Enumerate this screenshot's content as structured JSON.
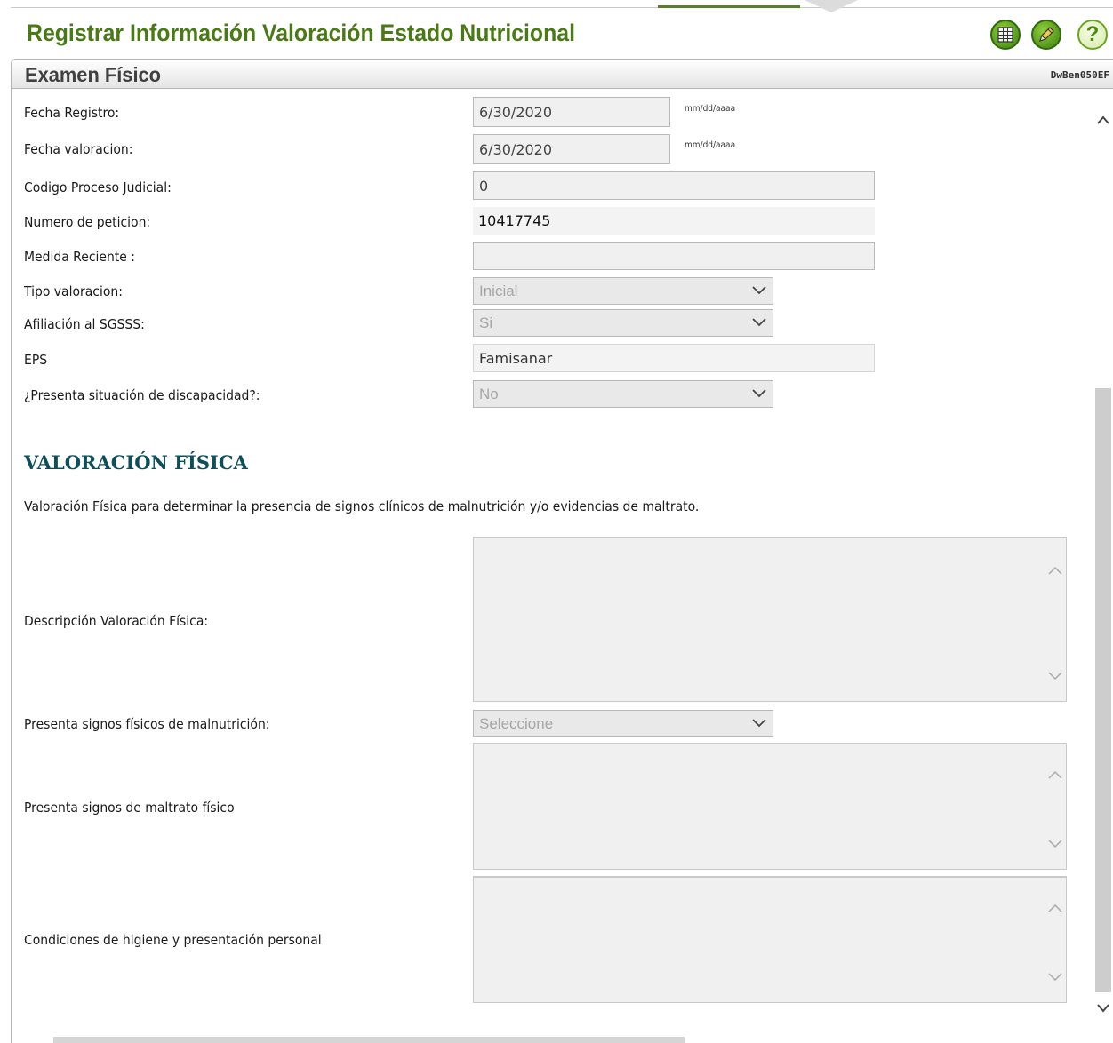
{
  "header": {
    "title": "Registrar Información Valoración Estado Nutricional",
    "icons": [
      "grid-icon",
      "edit-pencil-icon",
      "help-icon"
    ],
    "help_glyph": "?"
  },
  "section": {
    "title": "Examen Físico",
    "form_code": "DwBen050EF"
  },
  "form": {
    "fecha_registro": {
      "label": "Fecha Registro:",
      "value": "6/30/2020",
      "hint": "mm/dd/aaaa"
    },
    "fecha_valoracion": {
      "label": "Fecha valoracion:",
      "value": "6/30/2020",
      "hint": "mm/dd/aaaa"
    },
    "codigo_proceso": {
      "label": "Codigo Proceso Judicial:",
      "value": "0"
    },
    "numero_peticion": {
      "label": "Numero de peticion:",
      "value": "10417745"
    },
    "medida_reciente": {
      "label": "Medida Reciente :",
      "value": ""
    },
    "tipo_valoracion": {
      "label": "Tipo valoracion:",
      "selected": "Inicial"
    },
    "afiliacion": {
      "label": "Afiliación al SGSSS:",
      "selected": "Si"
    },
    "eps": {
      "label": "EPS",
      "value": "Famisanar"
    },
    "discapacidad": {
      "label": "¿Presenta situación de discapacidad?:",
      "selected": "No"
    }
  },
  "valoracion": {
    "heading": "VALORACIÓN FÍSICA",
    "description": "Valoración Física para determinar la presencia de signos clínicos de malnutrición y/o evidencias de maltrato.",
    "descripcion_label": "Descripción Valoración Física:",
    "malnutricion_label": "Presenta signos físicos de malnutrición:",
    "malnutricion_selected": "Seleccione",
    "maltrato_label": "Presenta signos de maltrato físico",
    "higiene_label": "Condiciones de higiene y presentación personal"
  },
  "colors": {
    "title_green": "#4a7a16",
    "heading_teal": "#0f4f5a"
  }
}
